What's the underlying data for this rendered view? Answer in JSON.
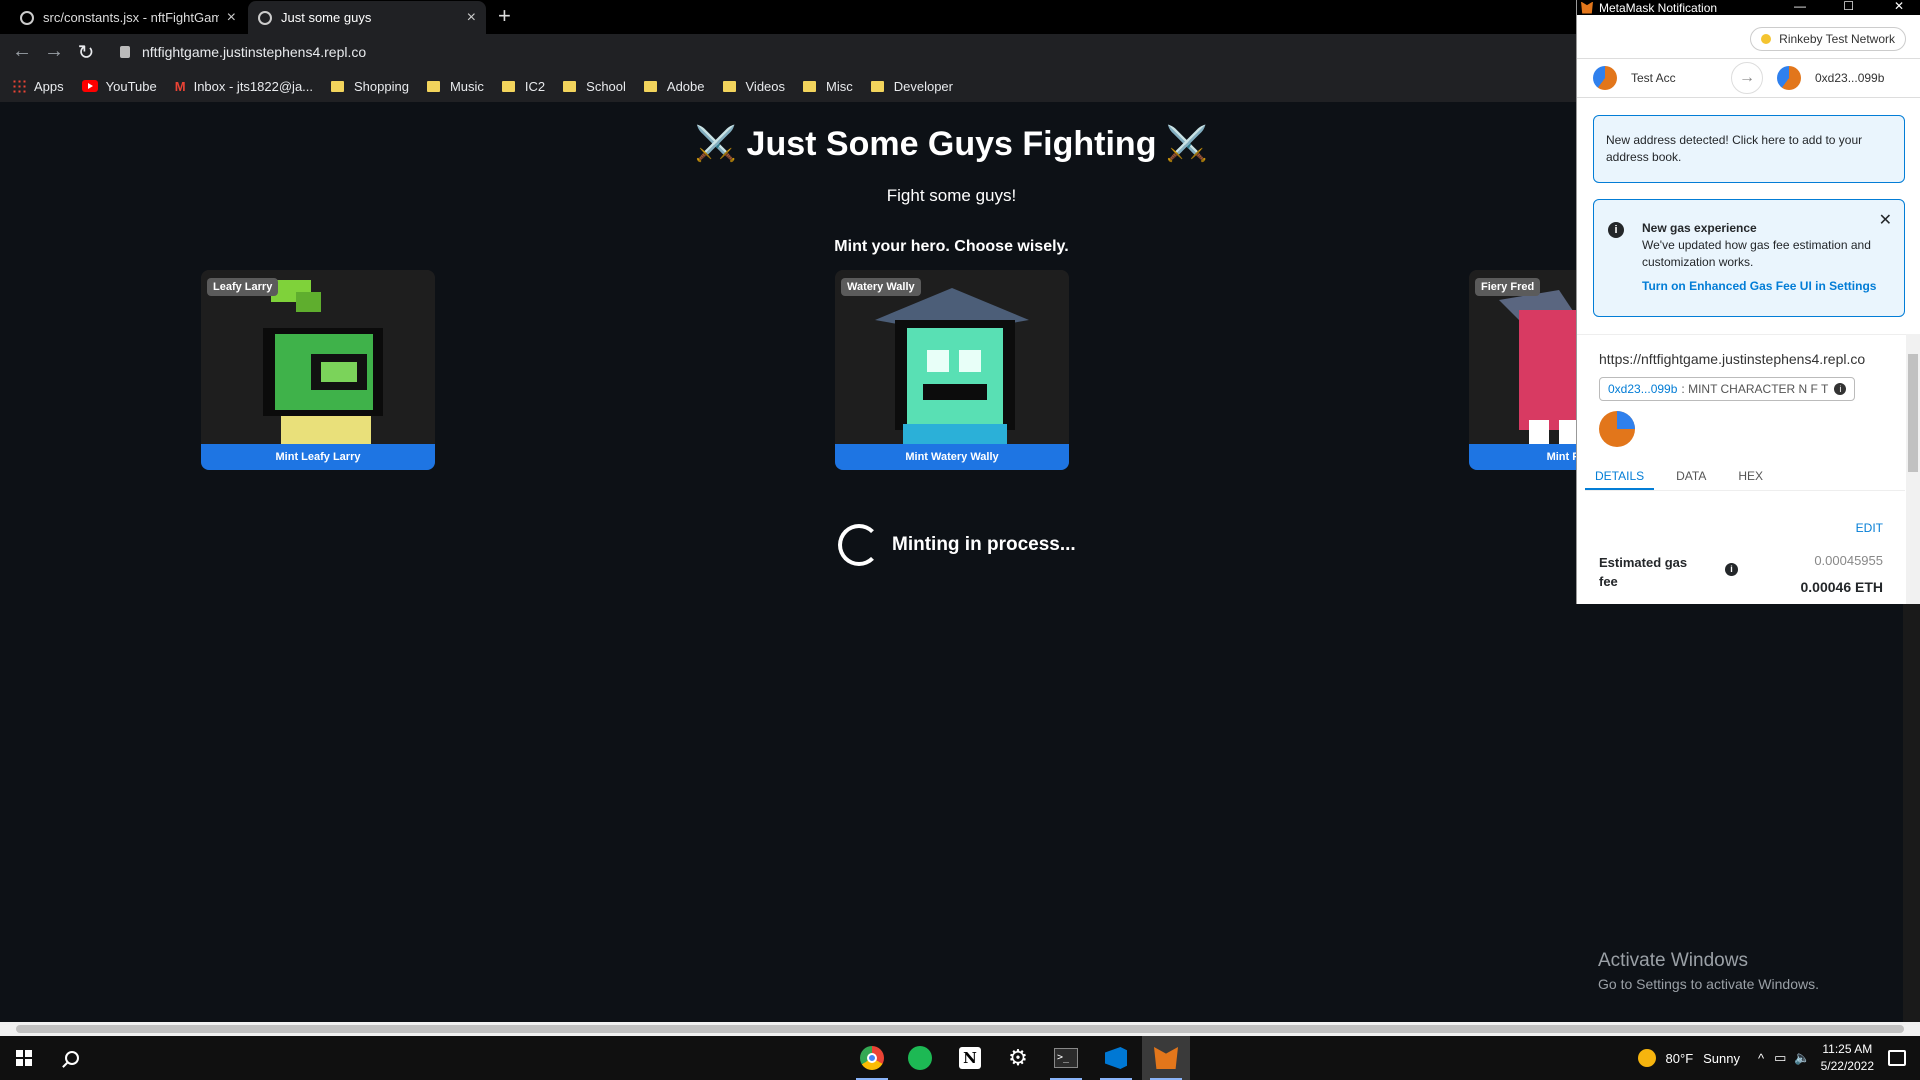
{
  "browser": {
    "tabs": [
      {
        "title": "src/constants.jsx - nftFightGame",
        "active": false
      },
      {
        "title": "Just some guys",
        "active": true
      }
    ],
    "url": "nftfightgame.justinstephens4.repl.co",
    "bookmarks": [
      "Apps",
      "YouTube",
      "Inbox - jts1822@ja...",
      "Shopping",
      "Music",
      "IC2",
      "School",
      "Adobe",
      "Videos",
      "Misc",
      "Developer"
    ]
  },
  "page": {
    "title": "⚔️ Just Some Guys Fighting ⚔️",
    "subtitle": "Fight some guys!",
    "mint_heading": "Mint your hero. Choose wisely.",
    "characters": [
      {
        "name": "Leafy Larry",
        "button": "Mint Leafy Larry"
      },
      {
        "name": "Watery Wally",
        "button": "Mint Watery Wally"
      },
      {
        "name": "Fiery Fred",
        "button": "Mint Fiery Fred"
      }
    ],
    "loading_text": "Minting in process..."
  },
  "activate_windows": {
    "line1": "Activate Windows",
    "line2": "Go to Settings to activate Windows."
  },
  "metamask": {
    "window_title": "MetaMask Notification",
    "network": "Rinkeby Test Network",
    "from_account": "Test Acc",
    "to_account": "0xd23...099b",
    "alert_address": "New address detected! Click here to add to your address book.",
    "gas_alert": {
      "title": "New gas experience",
      "body": "We've updated how gas fee estimation and customization works.",
      "link": "Turn on Enhanced Gas Fee UI in Settings"
    },
    "origin": "https://nftfightgame.justinstephens4.repl.co",
    "method_address": "0xd23...099b",
    "method_name": ": MINT CHARACTER N F T",
    "tabs": [
      "DETAILS",
      "DATA",
      "HEX"
    ],
    "edit_label": "EDIT",
    "gas_label": "Estimated gas fee",
    "gas_value": "0.00045955",
    "gas_eth": "0.00046 ETH"
  },
  "taskbar": {
    "weather_temp": "80°F",
    "weather_desc": "Sunny",
    "time": "11:25 AM",
    "date": "5/22/2022"
  }
}
